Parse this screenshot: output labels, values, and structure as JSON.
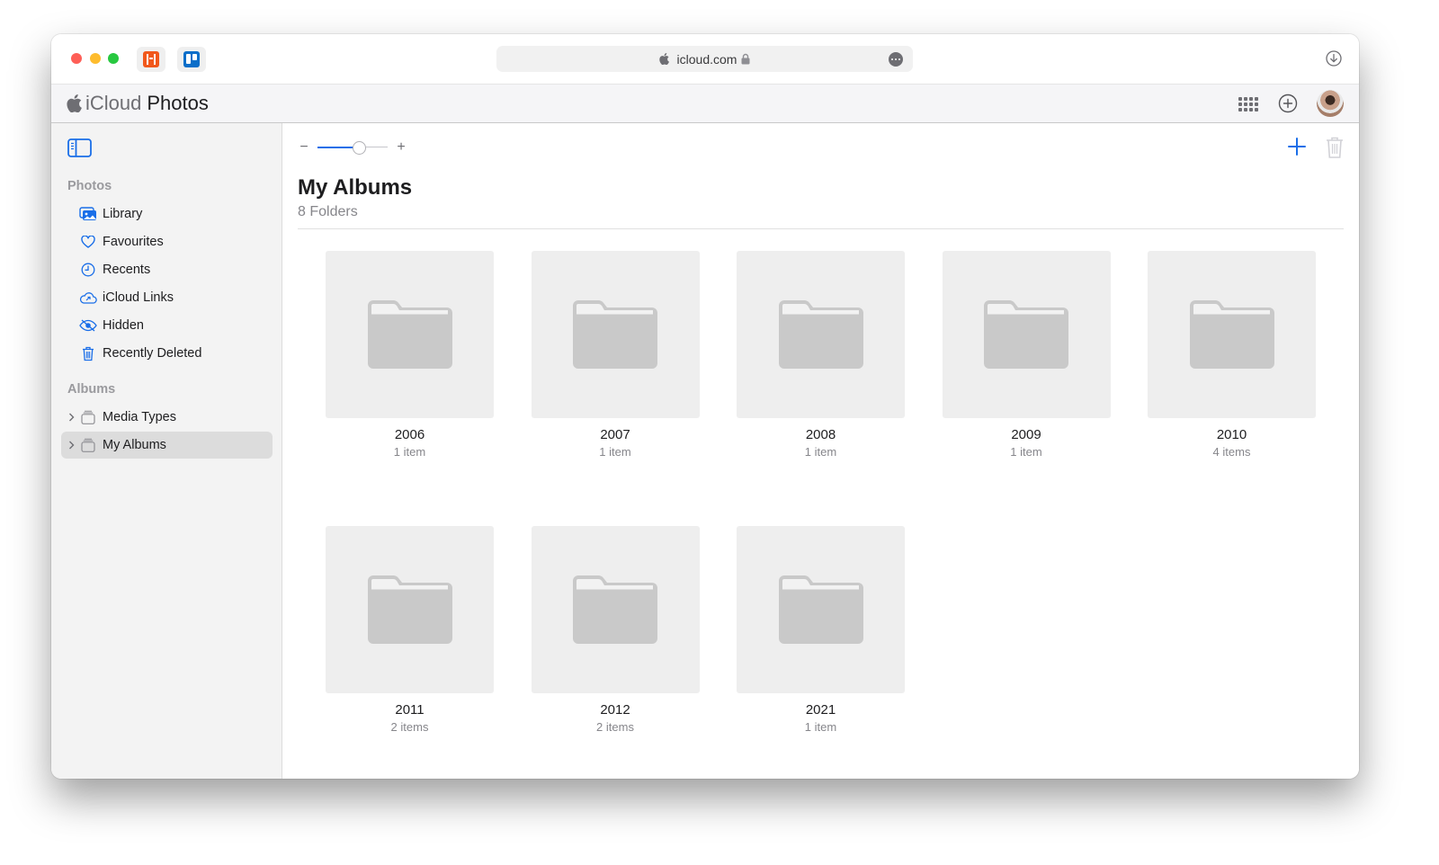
{
  "browser": {
    "url": "icloud.com",
    "extensions": [
      {
        "name": "harvest-extension",
        "icon": "harvest-icon",
        "color": "#f1581b"
      },
      {
        "name": "trello-extension",
        "icon": "trello-icon",
        "color": "#0a6ec9"
      }
    ],
    "download_icon": "download-icon",
    "more_icon": "ellipsis-icon"
  },
  "header": {
    "brand_prefix": "iCloud",
    "brand_app": "Photos",
    "apps_icon": "app-grid-icon",
    "add_icon": "plus-circle-icon",
    "avatar_icon": "user-avatar"
  },
  "sidebar": {
    "toggle_icon": "sidebar-toggle-icon",
    "photos_section": "Photos",
    "photos_items": [
      {
        "label": "Library",
        "icon": "library-icon"
      },
      {
        "label": "Favourites",
        "icon": "heart-icon"
      },
      {
        "label": "Recents",
        "icon": "clock-icon"
      },
      {
        "label": "iCloud Links",
        "icon": "cloud-link-icon"
      },
      {
        "label": "Hidden",
        "icon": "eye-slash-icon"
      },
      {
        "label": "Recently Deleted",
        "icon": "trash-icon"
      }
    ],
    "albums_section": "Albums",
    "album_items": [
      {
        "label": "Media Types",
        "icon": "album-stack-icon",
        "selected": false
      },
      {
        "label": "My Albums",
        "icon": "album-stack-icon",
        "selected": true
      }
    ]
  },
  "main": {
    "zoom": {
      "minus": "−",
      "plus": "+",
      "value_fraction": 0.62
    },
    "title": "My Albums",
    "subtitle": "8 Folders",
    "accent_color": "#1a6ee8",
    "folders": [
      {
        "name": "2006",
        "count": "1 item"
      },
      {
        "name": "2007",
        "count": "1 item"
      },
      {
        "name": "2008",
        "count": "1 item"
      },
      {
        "name": "2009",
        "count": "1 item"
      },
      {
        "name": "2010",
        "count": "4 items"
      },
      {
        "name": "2011",
        "count": "2 items"
      },
      {
        "name": "2012",
        "count": "2 items"
      },
      {
        "name": "2021",
        "count": "1 item"
      }
    ]
  }
}
